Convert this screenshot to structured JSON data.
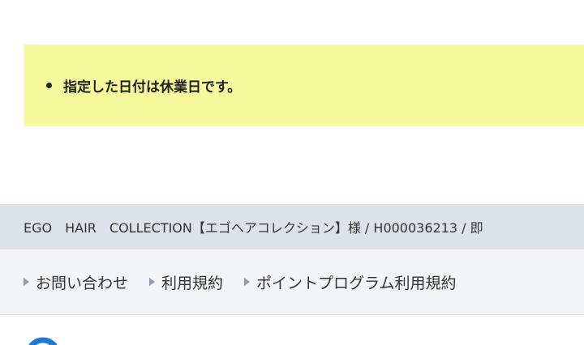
{
  "notice": {
    "messages": [
      "指定した日付は休業日です。"
    ]
  },
  "shop_bar": {
    "text": "EGO　HAIR　COLLECTION【エゴヘアコレクション】様 / H000036213 / 即"
  },
  "footer_links": [
    {
      "label": "お問い合わせ"
    },
    {
      "label": "利用規約"
    },
    {
      "label": "ポイントプログラム利用規約"
    }
  ],
  "colors": {
    "notice_bg": "#f7f99d",
    "shop_bar_bg": "#dde1ea",
    "footer_bg": "#f3f4f7",
    "link_marker": "#8a9ab3",
    "logo_blue": "#1e78d7"
  },
  "logo": {
    "icon": "brand-logo-icon"
  }
}
